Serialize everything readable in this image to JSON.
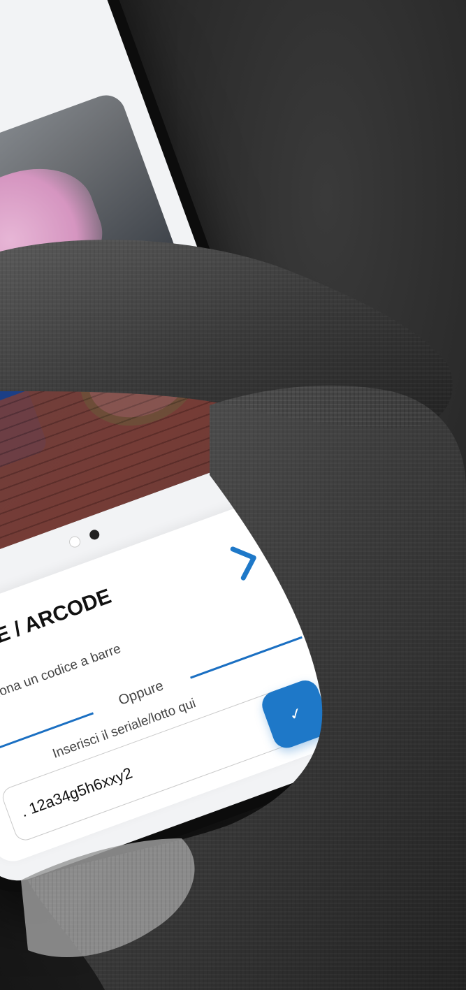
{
  "scanner_panel": {
    "title": "CODE / ARCODE",
    "description": "cansiona un codice a barre",
    "divider_text": "Oppure",
    "serial_label": "Inserisci il seriale/lotto qui",
    "serial_input": {
      "value": "",
      "placeholder": ". 12a34g5h6xxy2"
    },
    "confirm_button_label": "✓",
    "next_icon": "chevron-right-icon"
  },
  "carousel": {
    "dots": 2,
    "active_index": 0
  },
  "colors": {
    "accent": "#1e78c8",
    "background": "#1f1f1f",
    "glove": "#4a4a4a"
  }
}
